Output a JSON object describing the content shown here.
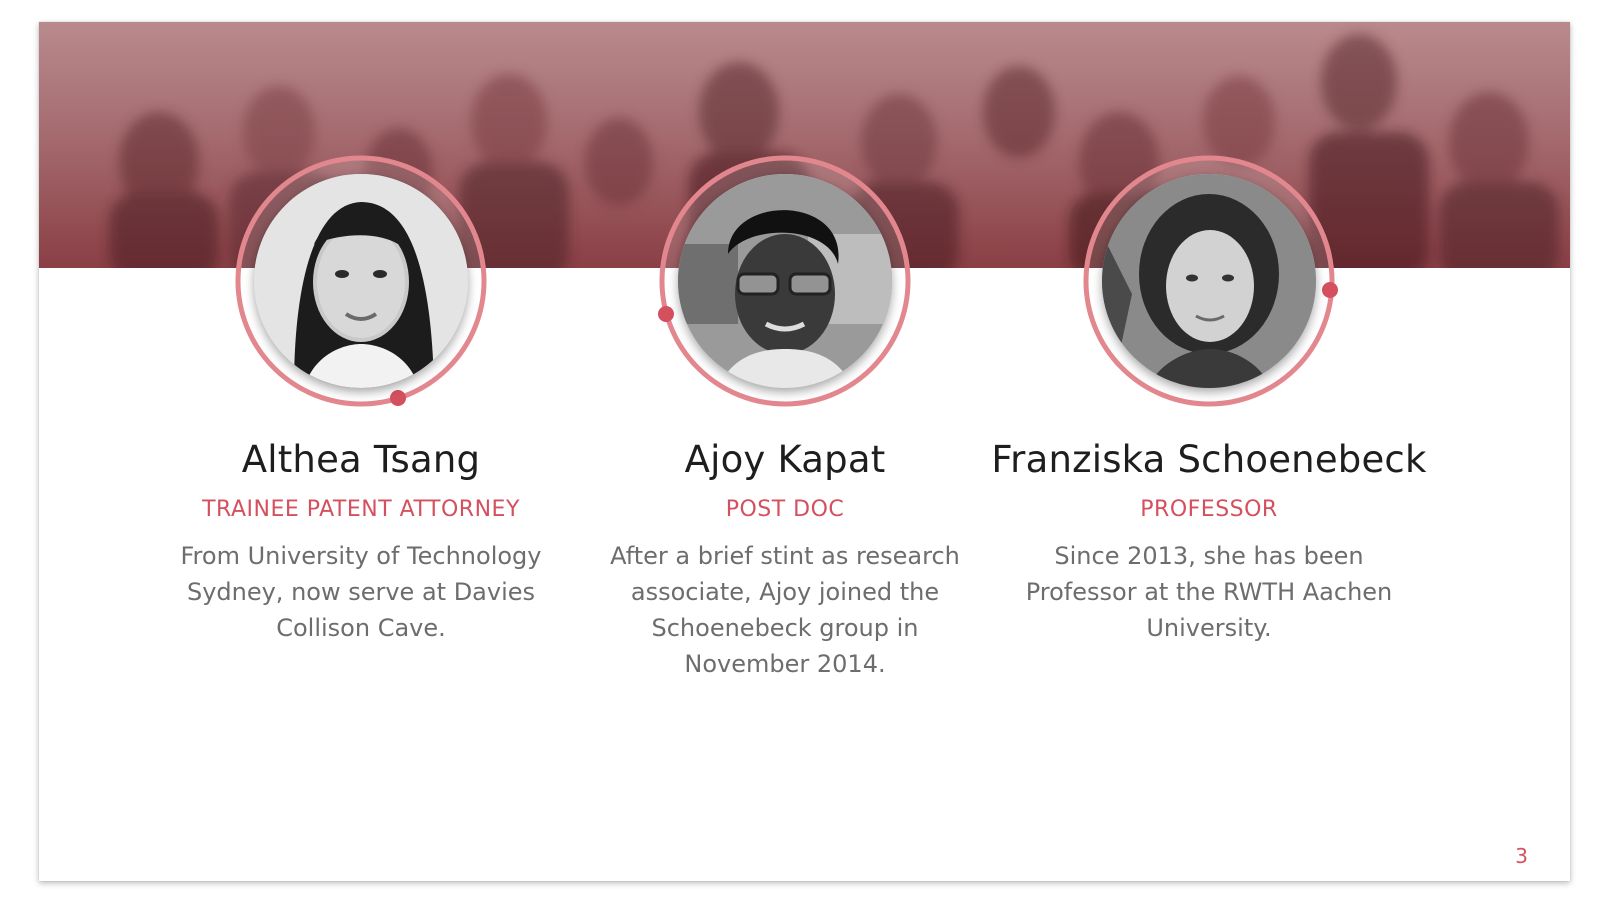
{
  "slide": {
    "page_number": "3",
    "accent_color": "#d4505f",
    "banner_image": "group-photo-background"
  },
  "team": [
    {
      "name": "Althea Tsang",
      "role": "TRAINEE PATENT ATTORNEY",
      "bio": "From University of Technology Sydney, now serve at Davies Collison Cave.",
      "photo": "portrait-photo"
    },
    {
      "name": "Ajoy Kapat",
      "role": "POST DOC",
      "bio": "After a brief stint as research associate, Ajoy joined the Schoenebeck group in November 2014.",
      "photo": "portrait-photo"
    },
    {
      "name": "Franziska Schoenebeck",
      "role": "PROFESSOR",
      "bio": "Since 2013, she has been Professor at the RWTH Aachen University.",
      "photo": "portrait-photo"
    }
  ]
}
